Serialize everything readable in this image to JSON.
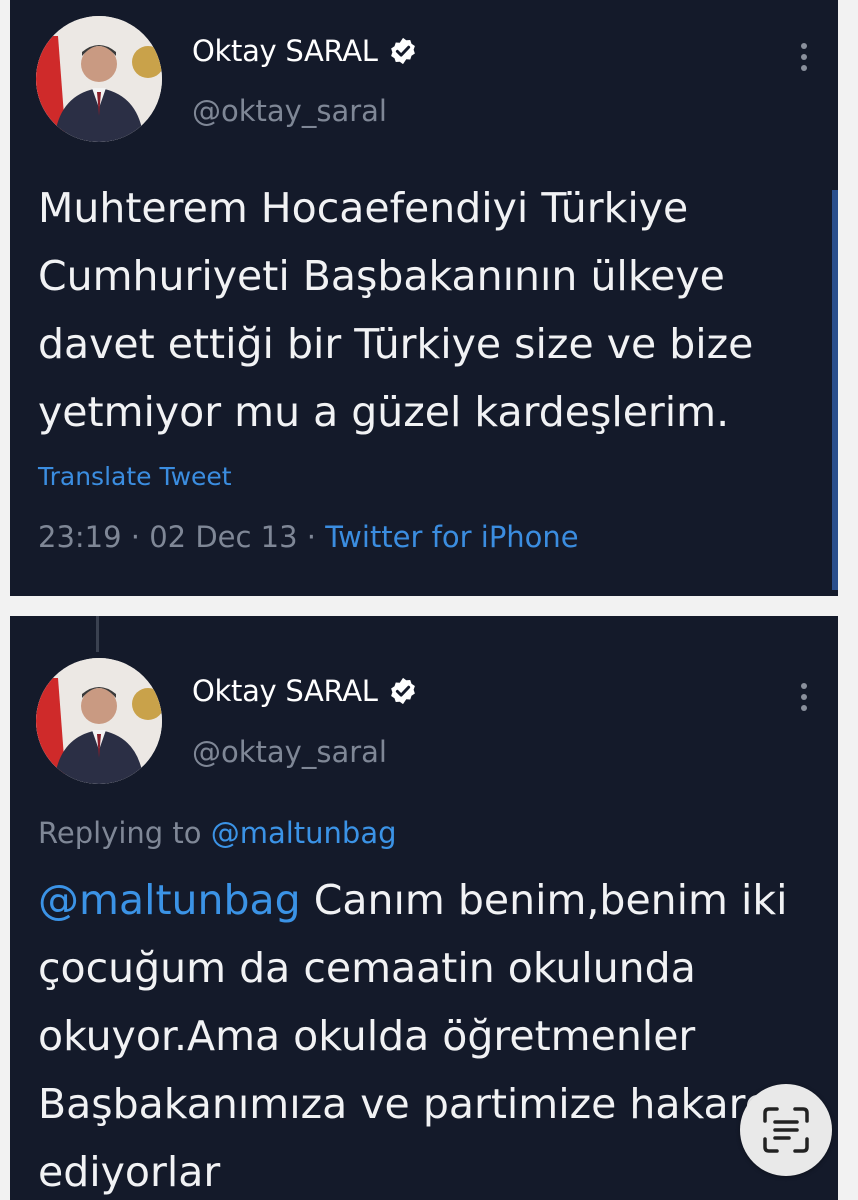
{
  "tweets": [
    {
      "author": {
        "name": "Oktay SARAL",
        "handle": "@oktay_saral",
        "verified": true
      },
      "text": "Muhterem Hocaefendiyi Türkiye Cumhuriyeti Başbakanının ülkeye davet ettiği bir Türkiye size ve bize yetmiyor mu a güzel kardeşlerim.",
      "translate_label": "Translate Tweet",
      "timestamp": "23:19 · 02 Dec 13 ·",
      "source": "Twitter for iPhone"
    },
    {
      "author": {
        "name": "Oktay SARAL",
        "handle": "@oktay_saral",
        "verified": true
      },
      "replying_label": "Replying to",
      "replying_to": "@maltunbag",
      "mention": "@maltunbag",
      "text": "Canım benim,benim iki çocuğum da cemaatin okulunda okuyor.Ama okulda öğretmenler Başbakanımıza ve partimize hakaret ediyorlar"
    }
  ],
  "icons": {
    "verified": "verified-badge-icon",
    "more": "more-vertical-icon",
    "scan": "text-scan-icon"
  },
  "colors": {
    "card_background": "#141a2a",
    "link": "#3b8de0",
    "muted": "#7f8796"
  }
}
